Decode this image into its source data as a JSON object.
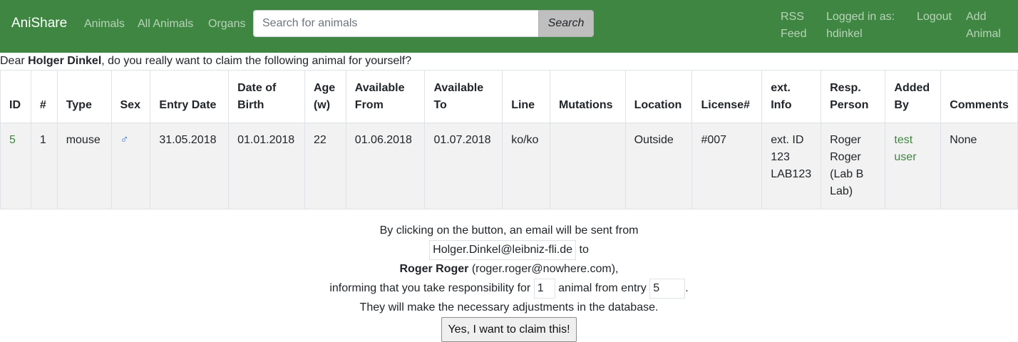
{
  "navbar": {
    "brand": "AniShare",
    "links": [
      "Animals",
      "All Animals",
      "Organs"
    ],
    "search_placeholder": "Search for animals",
    "search_button": "Search",
    "rss_line1": "RSS",
    "rss_line2": "Feed",
    "logged_in_line1": "Logged in as:",
    "logged_in_user": "hdinkel",
    "logout": "Logout",
    "add_line1": "Add",
    "add_line2": "Animal"
  },
  "greeting": {
    "prefix": "Dear ",
    "name": "Holger Dinkel",
    "suffix": ", do you really want to claim the following animal for yourself?"
  },
  "table": {
    "headers": {
      "id": "ID",
      "count": "#",
      "type": "Type",
      "sex": "Sex",
      "entry_date": "Entry Date",
      "dob_1": "Date of",
      "dob_2": "Birth",
      "age_1": "Age",
      "age_2": "(w)",
      "from_1": "Available",
      "from_2": "From",
      "to_1": "Available",
      "to_2": "To",
      "line": "Line",
      "mutations": "Mutations",
      "location": "Location",
      "license": "License#",
      "ext_1": "ext.",
      "ext_2": "Info",
      "resp_1": "Resp.",
      "resp_2": "Person",
      "added_1": "Added",
      "added_2": "By",
      "comments": "Comments"
    },
    "row": {
      "id": "5",
      "count": "1",
      "type": "mouse",
      "sex": "♂",
      "entry_date": "31.05.2018",
      "dob": "01.01.2018",
      "age": "22",
      "from": "01.06.2018",
      "to": "01.07.2018",
      "line": "ko/ko",
      "mutations": "",
      "location": "Outside",
      "license": "#007",
      "ext_1": "ext. ID",
      "ext_2": "123",
      "ext_3": "LAB123",
      "resp_1": "Roger",
      "resp_2": "Roger",
      "resp_3": "(Lab B",
      "resp_4": "Lab)",
      "added_1": "test",
      "added_2": "user",
      "comments": "None"
    }
  },
  "confirm": {
    "line1": "By clicking on the button, an email will be sent from",
    "from_email": "Holger.Dinkel@leibniz-fli.de",
    "to_word": " to",
    "recipient_name": "Roger Roger",
    "recipient_email": " (roger.roger@nowhere.com),",
    "resp_prefix": "informing that you take responsibility for ",
    "amount": "1",
    "resp_middle": " animal from entry ",
    "entry": "5",
    "resp_suffix": ".",
    "line5": "They will make the necessary adjustments in the database.",
    "button": "Yes, I want to claim this!"
  },
  "colors": {
    "navbar": "#3f8642",
    "link": "#3f8642",
    "nav_text": "#b7d4b8",
    "male_symbol": "#3b6fd4"
  }
}
